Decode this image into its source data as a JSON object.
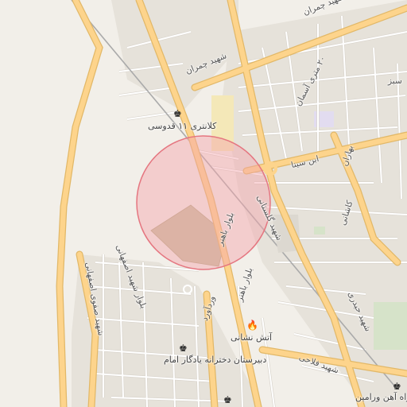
{
  "labels": {
    "kalantari": "کلانتری ۱۱ قدوسی",
    "atashneshani": "آتش نشانی",
    "dabirestan": "دبیرستان دخترانه یادگار امام",
    "rahAhan": "راه آهن ورامین",
    "shahidChamran_top": "شهید چمران",
    "shahidChamran_mid": "شهید چمران",
    "metriAseman": "۲۰ متری آسمان",
    "ebnSina": "ابن سینا",
    "bahar": "بهاران",
    "kashani": "کاشانی",
    "shahidHeydari": "شهید حیدری",
    "shahidFallahi": "شهید فلاحی",
    "bolvarBahonar": "بلوار باهنر",
    "bolvarBahonar2": "بلوار باهنر",
    "shahidKolestani": "شهید گلستانی",
    "vardavard": "وردآورد",
    "bolvarEsfahani": "بلوار شهید اصفهانی",
    "shahidSafavi": "شهید صفوی اصفهانی",
    "sabz": "سبز"
  },
  "colors": {
    "background": "#f2efe9",
    "primary_road": "#fdd48c",
    "primary_road_casing": "#e2b868",
    "minor_road": "#ffffff",
    "minor_road_casing": "#d9d4cc",
    "highlight_circle_fill": "#f3a3ab",
    "highlight_circle_stroke": "#e57680",
    "military_area": "#c8bfa0",
    "residential": "#e4e0d8",
    "railway": "#aaaaaa"
  },
  "icons": {
    "police": "police-icon",
    "fire": "fire-station-icon",
    "school": "school-icon",
    "train": "train-station-icon"
  },
  "highlight": {
    "shape": "circle"
  }
}
